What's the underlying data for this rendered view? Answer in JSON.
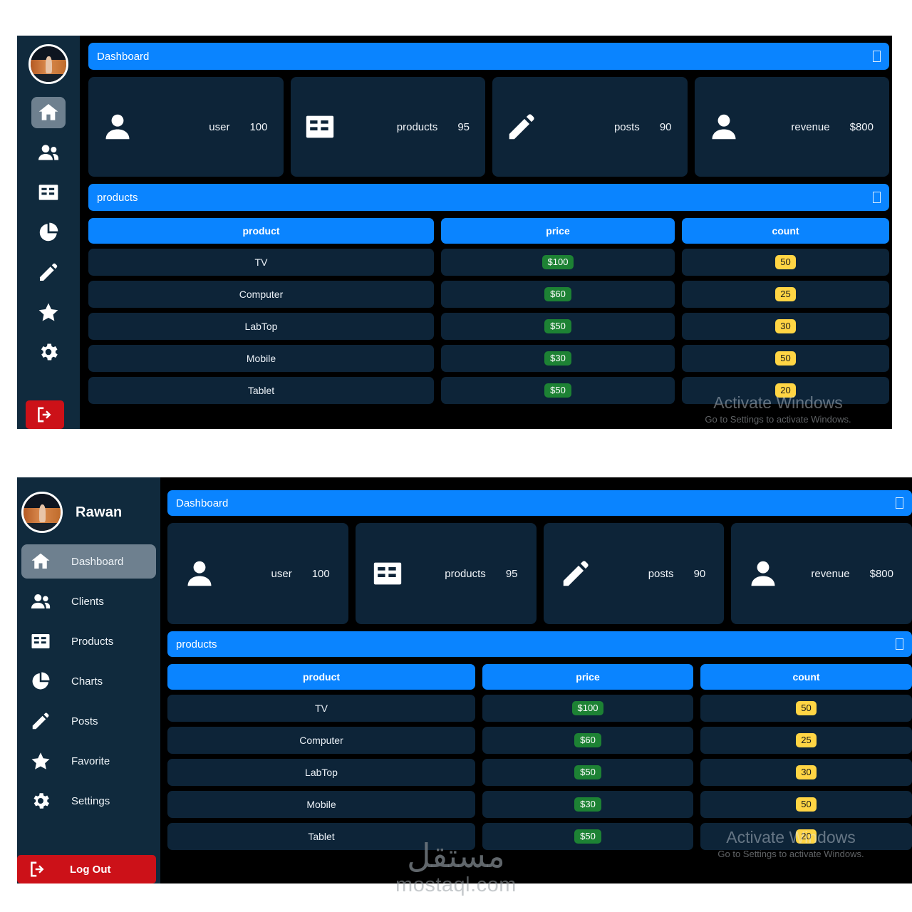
{
  "app": {
    "user_name": "Rawan",
    "avatar_alt": "user-avatar-photo",
    "colors": {
      "accent_blue": "#0a84ff",
      "sidebar_navy": "#102a3d",
      "card_navy": "#0d2438",
      "page_black": "#000000",
      "logout_red": "#cc1118",
      "price_green": "#1d8234",
      "count_yellow": "#ffd544",
      "active_nav": "#6e808f"
    }
  },
  "sidebar": {
    "items": [
      {
        "label": "Dashboard",
        "icon": "home-icon",
        "active": true
      },
      {
        "label": "Clients",
        "icon": "people-icon",
        "active": false
      },
      {
        "label": "Products",
        "icon": "table-icon",
        "active": false
      },
      {
        "label": "Charts",
        "icon": "pie-chart-icon",
        "active": false
      },
      {
        "label": "Posts",
        "icon": "pencil-icon",
        "active": false
      },
      {
        "label": "Favorite",
        "icon": "star-icon",
        "active": false
      },
      {
        "label": "Settings",
        "icon": "gear-icon",
        "active": false
      }
    ],
    "logout": {
      "label": "Log Out",
      "icon": "logout-icon"
    }
  },
  "header": {
    "dashboard_title": "Dashboard",
    "products_title": "products",
    "corner_glyph": "missing-glyph-box"
  },
  "stats": [
    {
      "label": "user",
      "value": "100",
      "icon": "person-icon"
    },
    {
      "label": "products",
      "value": "95",
      "icon": "table-icon"
    },
    {
      "label": "posts",
      "value": "90",
      "icon": "pencil-icon"
    },
    {
      "label": "revenue",
      "value": "$800",
      "icon": "person-icon"
    }
  ],
  "products_table": {
    "columns": [
      "product",
      "price",
      "count"
    ],
    "rows": [
      {
        "product": "TV",
        "price": "$100",
        "count": "50"
      },
      {
        "product": "Computer",
        "price": "$60",
        "count": "25"
      },
      {
        "product": "LabTop",
        "price": "$50",
        "count": "30"
      },
      {
        "product": "Mobile",
        "price": "$30",
        "count": "50"
      },
      {
        "product": "Tablet",
        "price": "$50",
        "count": "20"
      }
    ]
  },
  "activate_windows": {
    "line1": "Activate Windows",
    "line2": "Go to Settings to activate Windows."
  },
  "watermark": {
    "arabic": "مستقل",
    "latin": "mostaql.com"
  }
}
